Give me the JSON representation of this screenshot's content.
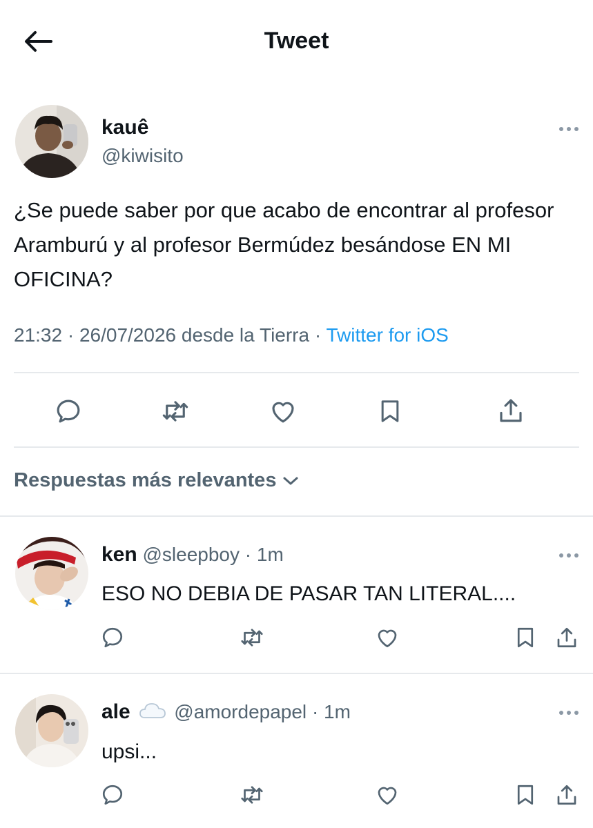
{
  "header": {
    "title": "Tweet",
    "back_icon": "arrow-left-icon"
  },
  "tweet": {
    "author_name": "kauê",
    "author_handle": "@kiwisito",
    "text": "¿Se puede saber por que acabo de encontrar al profesor Aramburú y al profesor Bermúdez besándose EN MI OFICINA?",
    "meta_prefix": "21:32 · 26/07/2026 desde la Tierra · ",
    "source": "Twitter for iOS",
    "actions": [
      "reply-icon",
      "retweet-icon",
      "like-icon",
      "bookmark-icon",
      "share-icon"
    ]
  },
  "replies_sort": {
    "label": "Respuestas más relevantes"
  },
  "replies": [
    {
      "name": "ken",
      "handle": "@sleepboy",
      "time": "· 1m",
      "text": "ESO NO DEBIA DE PASAR TAN LITERAL...."
    },
    {
      "name": "ale",
      "badge": "cloud-emoji",
      "handle": "@amordepapel",
      "time": "· 1m",
      "text": "upsi..."
    }
  ],
  "colors": {
    "text": "#0f1419",
    "secondary": "#536471",
    "link": "#1d9bf0",
    "divider": "#e6e9ec"
  }
}
